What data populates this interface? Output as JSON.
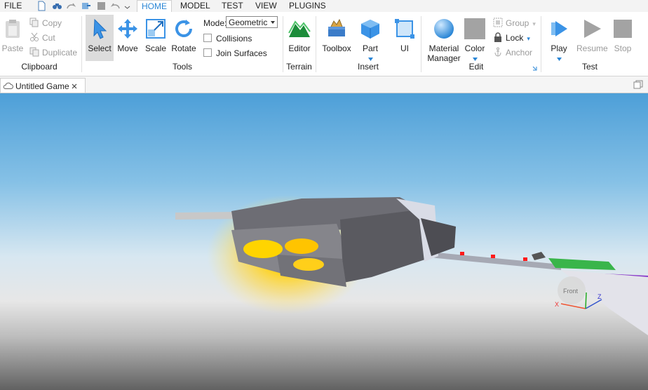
{
  "menubar": {
    "file": "FILE",
    "tabs": [
      "HOME",
      "MODEL",
      "TEST",
      "VIEW",
      "PLUGINS"
    ],
    "active_tab": "HOME"
  },
  "ribbon": {
    "clipboard": {
      "paste": "Paste",
      "copy": "Copy",
      "cut": "Cut",
      "duplicate": "Duplicate",
      "group_label": "Clipboard"
    },
    "tools": {
      "select": "Select",
      "move": "Move",
      "scale": "Scale",
      "rotate": "Rotate",
      "mode_label": "Mode:",
      "mode_value": "Geometric",
      "collisions": "Collisions",
      "join_surfaces": "Join Surfaces",
      "group_label": "Tools"
    },
    "terrain": {
      "editor": "Editor",
      "group_label": "Terrain"
    },
    "insert": {
      "toolbox": "Toolbox",
      "part": "Part",
      "ui": "UI",
      "group_label": "Insert"
    },
    "edit": {
      "material_line1": "Material",
      "material_line2": "Manager",
      "color": "Color",
      "group": "Group",
      "lock": "Lock",
      "anchor": "Anchor",
      "group_label": "Edit"
    },
    "test": {
      "play": "Play",
      "resume": "Resume",
      "stop": "Stop",
      "group_label": "Test"
    }
  },
  "document_tab": {
    "title": "Untitled Game"
  },
  "viewport": {
    "view_cube_label": "Front"
  },
  "colors": {
    "accent": "#2a86d6",
    "select_bg": "#dcdcdc"
  }
}
